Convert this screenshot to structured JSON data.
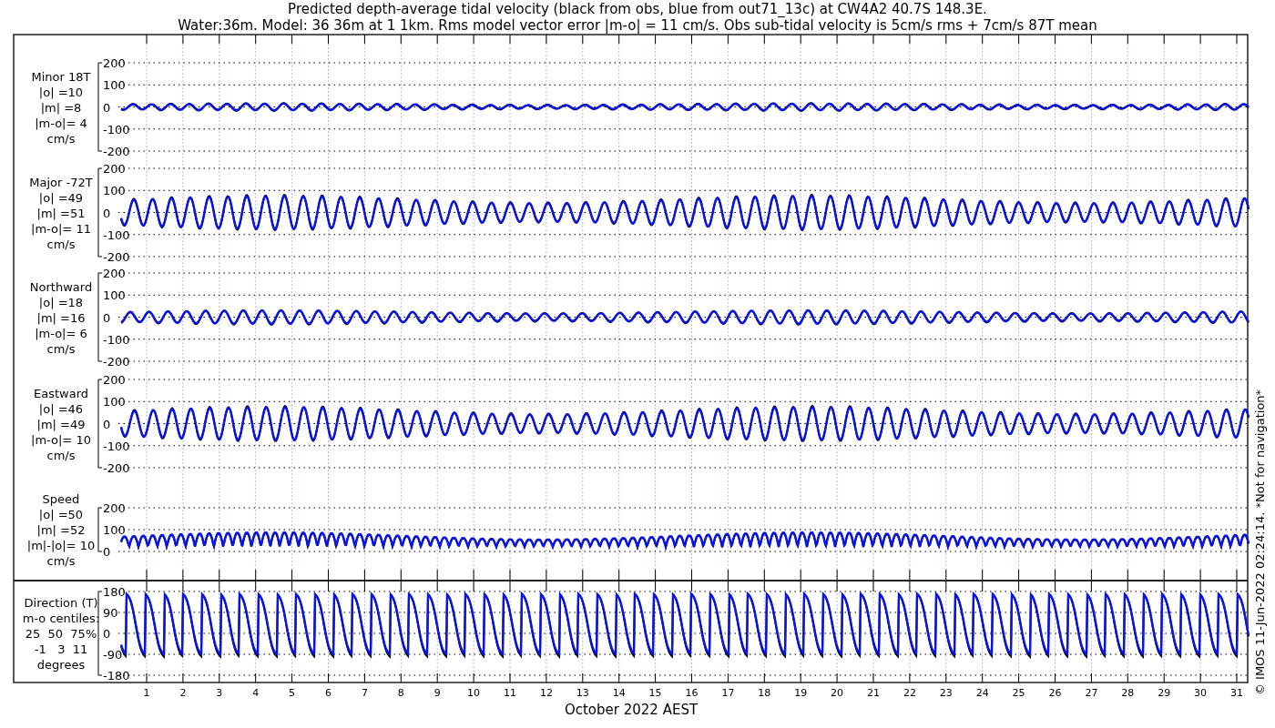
{
  "title_lines": [
    "Predicted depth-average tidal velocity (black from obs, blue from out71_13c) at CW4A2 40.7S 148.3E.",
    "Water:36m. Model: 36 36m at 1 1km. Rms model vector error |m-o| = 11 cm/s. Obs sub-tidal velocity is 5cm/s rms + 7cm/s 87T mean"
  ],
  "panels": [
    {
      "kind": "velocity",
      "label_lines": [
        "Minor 18T",
        "|o| =10",
        "|m| =8",
        "|m-o|= 4",
        "cm/s"
      ],
      "yticks": [
        "200",
        "100",
        "0",
        "-100",
        "-200"
      ]
    },
    {
      "kind": "velocity",
      "label_lines": [
        "Major -72T",
        "|o| =49",
        "|m| =51",
        "|m-o|= 11",
        "cm/s"
      ],
      "yticks": [
        "200",
        "100",
        "0",
        "-100",
        "-200"
      ]
    },
    {
      "kind": "velocity",
      "label_lines": [
        "Northward",
        "|o| =18",
        "|m| =16",
        "|m-o|= 6",
        "cm/s"
      ],
      "yticks": [
        "200",
        "100",
        "0",
        "-100",
        "-200"
      ]
    },
    {
      "kind": "velocity",
      "label_lines": [
        "Eastward",
        "|o| =46",
        "|m| =49",
        "|m-o|= 10",
        "cm/s"
      ],
      "yticks": [
        "200",
        "100",
        "0",
        "-100",
        "-200"
      ]
    },
    {
      "kind": "speed",
      "label_lines": [
        "Speed",
        "|o| =50",
        "|m| =52",
        "|m|-|o|= 10",
        "cm/s"
      ],
      "yticks": [
        "200",
        "100",
        "0"
      ]
    },
    {
      "kind": "direction",
      "label_lines": [
        "Direction (T)",
        "m-o centiles:",
        "25  50  75%",
        "-1   3  11",
        "degrees"
      ],
      "yticks": [
        "180",
        "90",
        "0",
        "-90",
        "-180"
      ]
    }
  ],
  "xticks": [
    "1",
    "2",
    "3",
    "4",
    "5",
    "6",
    "7",
    "8",
    "9",
    "10",
    "11",
    "12",
    "13",
    "14",
    "15",
    "16",
    "17",
    "18",
    "19",
    "20",
    "21",
    "22",
    "23",
    "24",
    "25",
    "26",
    "27",
    "28",
    "29",
    "30",
    "31"
  ],
  "xlabel": "October 2022 AEST",
  "side_note": "© IMOS 11-Jun-2022 02:24:14. *Not for navigation*"
}
